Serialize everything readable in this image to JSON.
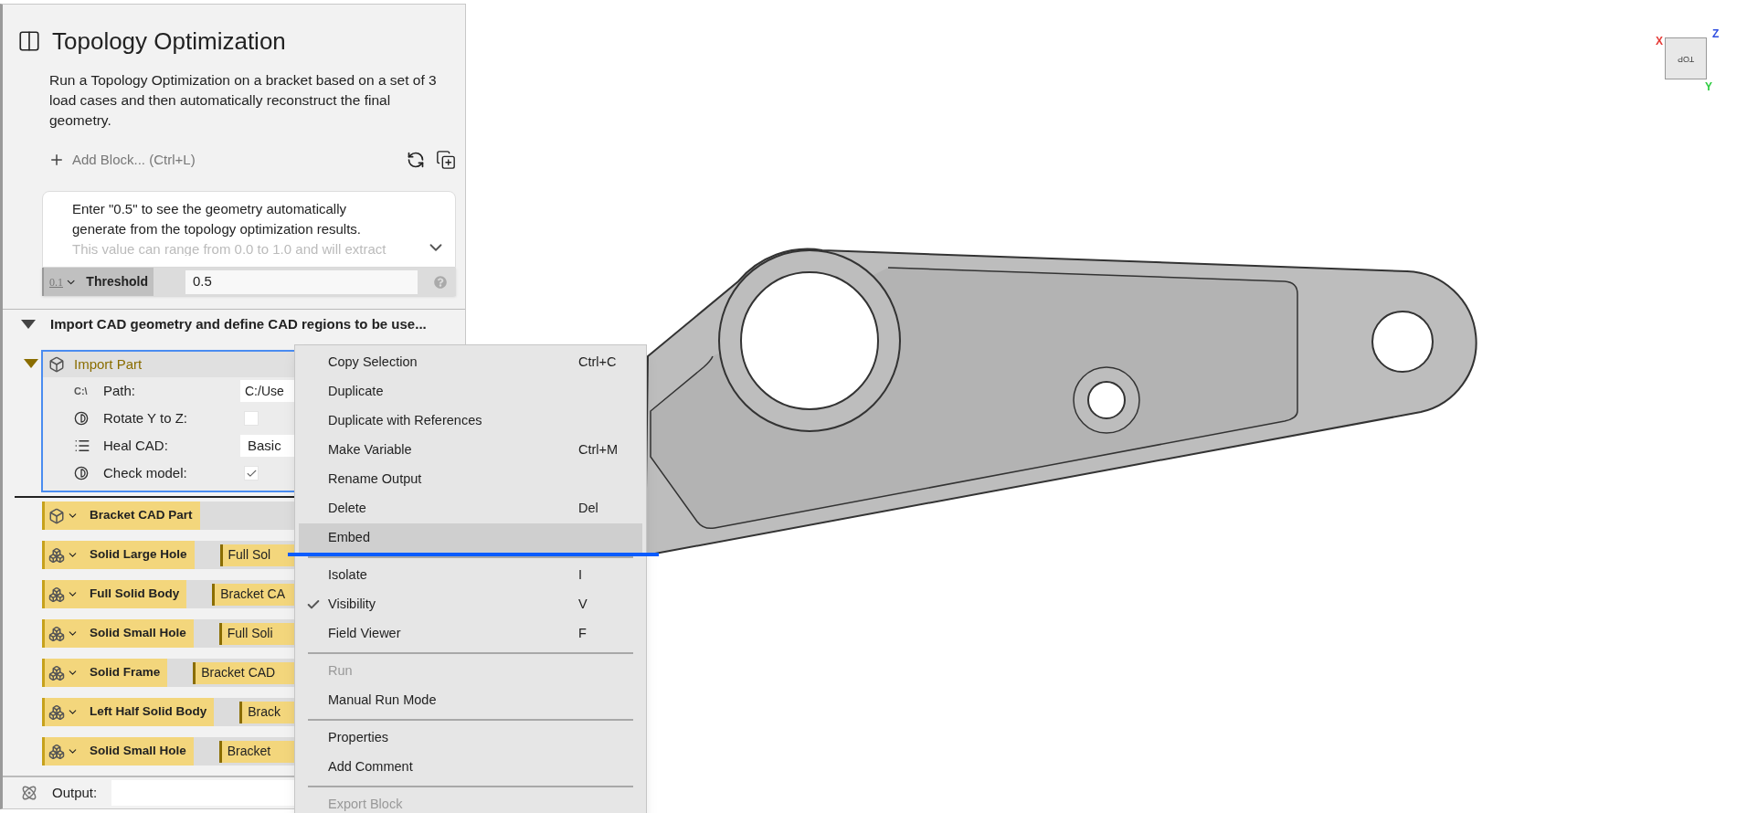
{
  "panel": {
    "title": "Topology Optimization",
    "description": "Run a Topology Optimization on a bracket based on a set of 3 load cases and then automatically reconstruct the final geometry.",
    "add_block": "Add Block... (Ctrl+L)",
    "comment": {
      "text": "Enter \"0.5\" to see the geometry automatically generate from the topology optimization results.",
      "faded_text": "This value can range from 0.0 to 1.0 and will extract"
    },
    "threshold": {
      "type_icon": "0.1",
      "label": "Threshold",
      "value": "0.5"
    },
    "section": {
      "title": "Import CAD geometry and define CAD regions to be use...",
      "expanded": true
    },
    "import_part": {
      "title": "Import Part",
      "expanded": true,
      "selected": true,
      "fields": [
        {
          "kind": "text",
          "icon_text": "C:\\",
          "label": "Path:",
          "value": "C:/Use"
        },
        {
          "kind": "checkbox",
          "label": "Rotate Y to Z:",
          "checked": false
        },
        {
          "kind": "dropdown",
          "label": "Heal CAD:",
          "value": "Basic"
        },
        {
          "kind": "checkbox",
          "label": "Check model:",
          "checked": true
        }
      ]
    },
    "blocks": [
      {
        "kind": "part",
        "name": "Bracket CAD Part"
      },
      {
        "kind": "region",
        "name": "Solid Large Hole",
        "reference": "Full Sol"
      },
      {
        "kind": "region",
        "name": "Full Solid Body",
        "reference": "Bracket CA"
      },
      {
        "kind": "region",
        "name": "Solid Small Hole",
        "reference": "Full Soli"
      },
      {
        "kind": "region",
        "name": "Solid Frame",
        "reference": "Bracket CAD"
      },
      {
        "kind": "region",
        "name": "Left Half Solid Body",
        "reference": "Brack"
      },
      {
        "kind": "region",
        "name": "Solid Small Hole",
        "reference": "Bracket"
      }
    ],
    "output": {
      "label": "Output:"
    }
  },
  "context_menu": {
    "items": [
      {
        "kind": "item",
        "label": "Copy Selection",
        "shortcut": "Ctrl+C",
        "disabled": false,
        "checked": false,
        "selected": false
      },
      {
        "kind": "item",
        "label": "Duplicate",
        "disabled": false,
        "checked": false,
        "selected": false
      },
      {
        "kind": "item",
        "label": "Duplicate with References",
        "disabled": false,
        "checked": false,
        "selected": false
      },
      {
        "kind": "item",
        "label": "Make Variable",
        "shortcut": "Ctrl+M",
        "disabled": false,
        "checked": false,
        "selected": false
      },
      {
        "kind": "item",
        "label": "Rename Output",
        "disabled": false,
        "checked": false,
        "selected": false
      },
      {
        "kind": "item",
        "label": "Delete",
        "shortcut": "Del",
        "disabled": false,
        "checked": false,
        "selected": false
      },
      {
        "kind": "item",
        "label": "Embed",
        "disabled": false,
        "checked": false,
        "selected": true
      },
      {
        "kind": "separator"
      },
      {
        "kind": "item",
        "label": "Isolate",
        "shortcut": "I",
        "disabled": false,
        "checked": false,
        "selected": false
      },
      {
        "kind": "item",
        "label": "Visibility",
        "shortcut": "V",
        "disabled": false,
        "checked": true,
        "selected": false
      },
      {
        "kind": "item",
        "label": "Field Viewer",
        "shortcut": "F",
        "disabled": false,
        "checked": false,
        "selected": false
      },
      {
        "kind": "separator"
      },
      {
        "kind": "item",
        "label": "Run",
        "disabled": true,
        "checked": false,
        "selected": false
      },
      {
        "kind": "item",
        "label": "Manual Run Mode",
        "disabled": false,
        "checked": false,
        "selected": false
      },
      {
        "kind": "separator"
      },
      {
        "kind": "item",
        "label": "Properties",
        "disabled": false,
        "checked": false,
        "selected": false
      },
      {
        "kind": "item",
        "label": "Add Comment",
        "disabled": false,
        "checked": false,
        "selected": false
      },
      {
        "kind": "separator"
      },
      {
        "kind": "item",
        "label": "Export Block",
        "disabled": true,
        "checked": false,
        "selected": false
      }
    ]
  },
  "nav_cube": {
    "face": "TOP",
    "axes": [
      {
        "label": "X",
        "color": "#e53935"
      },
      {
        "label": "Z",
        "color": "#2f4ee0"
      },
      {
        "label": "Y",
        "color": "#2ecc40"
      }
    ]
  }
}
